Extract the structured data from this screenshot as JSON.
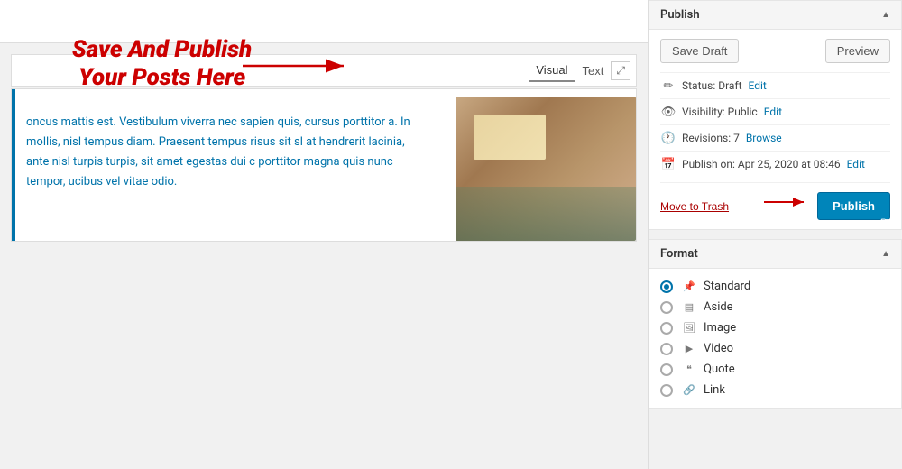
{
  "header": {
    "input_placeholder": ""
  },
  "annotation": {
    "line1": "Save And Publish",
    "line2": "Your Posts Here"
  },
  "editor": {
    "visual_tab": "Visual",
    "text_tab": "Text",
    "body_text": "oncus mattis est. Vestibulum viverra nec sapien quis, cursus porttitor a. In mollis, nisl tempus diam. Praesent tempus risus sit sl at hendrerit lacinia, ante nisl turpis turpis, sit amet egestas dui c porttitor magna quis nunc tempor, ucibus vel vitae odio."
  },
  "publish_box": {
    "title": "Publish",
    "save_draft_label": "Save Draft",
    "preview_label": "Preview",
    "status_label": "Status:",
    "status_value": "Draft",
    "status_edit": "Edit",
    "visibility_label": "Visibility:",
    "visibility_value": "Public",
    "visibility_edit": "Edit",
    "revisions_label": "Revisions:",
    "revisions_value": "7",
    "revisions_browse": "Browse",
    "publish_on_label": "Publish on:",
    "publish_on_value": "Apr 25, 2020 at 08:46",
    "publish_on_edit": "Edit",
    "move_to_trash_label": "Move to Trash",
    "publish_button_label": "Publish"
  },
  "format_box": {
    "title": "Format",
    "formats": [
      {
        "id": "standard",
        "label": "Standard",
        "checked": true,
        "icon": "📌"
      },
      {
        "id": "aside",
        "label": "Aside",
        "checked": false,
        "icon": "▤"
      },
      {
        "id": "image",
        "label": "Image",
        "checked": false,
        "icon": "🖼"
      },
      {
        "id": "video",
        "label": "Video",
        "checked": false,
        "icon": "▶"
      },
      {
        "id": "quote",
        "label": "Quote",
        "checked": false,
        "icon": "❝"
      },
      {
        "id": "link",
        "label": "Link",
        "checked": false,
        "icon": "🔗"
      }
    ]
  },
  "icons": {
    "collapse": "▲",
    "pencil": "✏",
    "eye": "👁",
    "clock": "🕐",
    "calendar": "📅",
    "fullscreen": "⤢"
  }
}
